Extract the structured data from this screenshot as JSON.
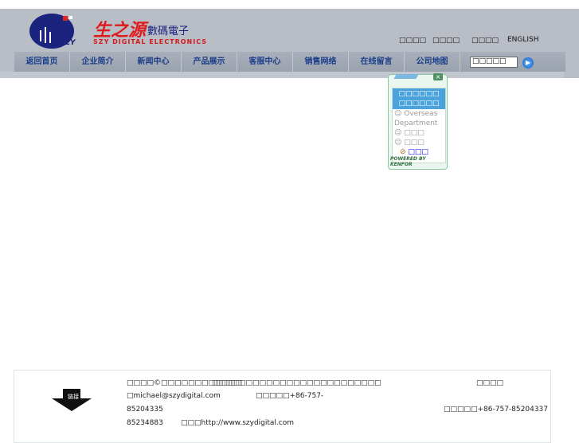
{
  "logo": {
    "brand_cn": "生之源",
    "brand_sub": "數碼電子",
    "brand_en": "SZY DIGITAL ELECTRONICS",
    "badge": "SZY"
  },
  "toplinks": [
    "□□□□",
    "□□□□",
    "□□□□",
    "ENGLISH"
  ],
  "nav": [
    "返回首页",
    "企业简介",
    "新闻中心",
    "产品展示",
    "客服中心",
    "销售网络",
    "在线留言",
    "公司地图"
  ],
  "search": {
    "value": "□□□□□"
  },
  "chat": {
    "header": "□□□□□□ □□□□□□",
    "items": [
      "Overseas Department",
      "□□□",
      "□□□"
    ],
    "link": "□□□",
    "powered": "POWERED BY KENFOR"
  },
  "footer": {
    "arrow_label": "链接",
    "copyright": "□□□□©□□□□□□□□□□□□",
    "address": "□□□□□□□□□□□□□□□□□□□□□□□□□",
    "right_title": "□□□□",
    "email": "□michael@szydigital.com",
    "phone1": "□□□□□+86-757-",
    "phone1b": "85204335",
    "fax": "□□□□□+86-757-85204337",
    "phone2": "85234883",
    "web": "□□□http://www.szydigital.com"
  }
}
